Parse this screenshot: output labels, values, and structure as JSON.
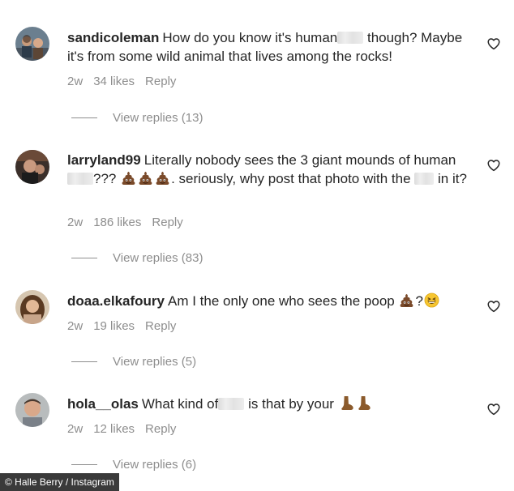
{
  "comments": [
    {
      "username": "sandicoleman",
      "text_1": "How do you know it's human",
      "text_2": "though? Maybe it's from some wild animal that lives among the rocks!",
      "age": "2w",
      "likes": "34 likes",
      "reply": "Reply",
      "view_replies": "View replies (13)"
    },
    {
      "username": "larryland99",
      "text_1": "Literally nobody sees the 3 giant mounds of human",
      "text_2": "???",
      "text_3": ". seriously, why post that photo with the",
      "text_4": "in it?",
      "age": "2w",
      "likes": "186 likes",
      "reply": "Reply",
      "view_replies": "View replies (83)"
    },
    {
      "username": "doaa.elkafoury",
      "text_1": "Am I the only one who sees the poop",
      "text_2": "?",
      "age": "2w",
      "likes": "19 likes",
      "reply": "Reply",
      "view_replies": "View replies (5)"
    },
    {
      "username": "hola__olas",
      "text_1": "What kind of",
      "text_2": "is that by your",
      "age": "2w",
      "likes": "12 likes",
      "reply": "Reply",
      "view_replies": "View replies (6)"
    }
  ],
  "caption": "© Halle Berry / Instagram",
  "icons": {
    "like": "heart-outline-icon",
    "poop": "pile-of-poo-emoji",
    "laugh": "grinning-squinting-face-emoji",
    "feet": "foot-emoji"
  },
  "colors": {
    "text": "#262626",
    "secondary": "#8e8e8e",
    "poop": "#7a4a2a",
    "foot": "#8b5a2b"
  }
}
